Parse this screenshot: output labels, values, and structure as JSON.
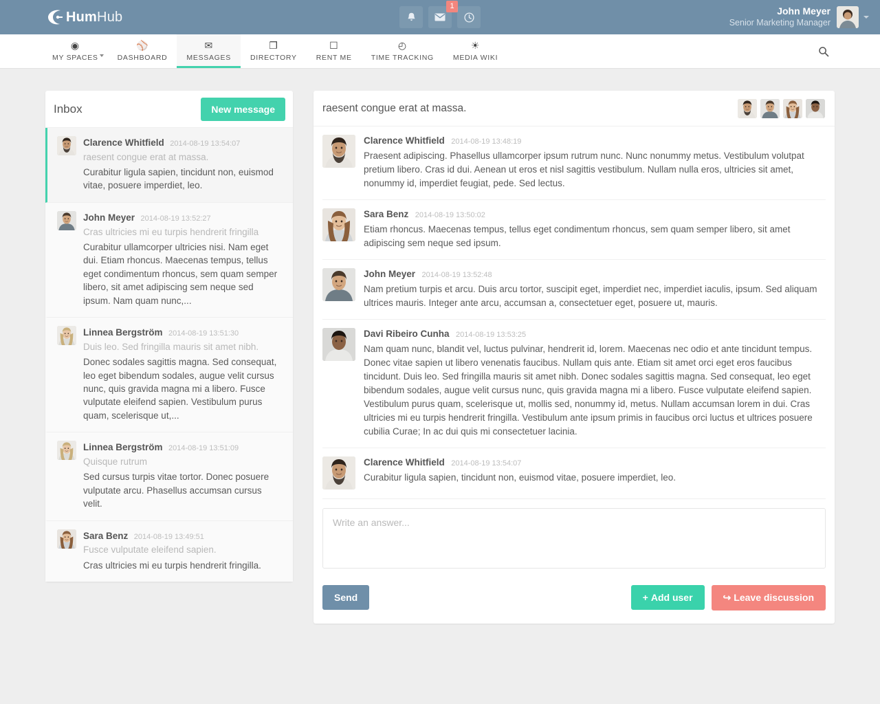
{
  "brand": {
    "name_bold": "Hum",
    "name_light": "Hub"
  },
  "topbar": {
    "icons": [
      {
        "name": "notifications-icon",
        "glyph": "⚑"
      },
      {
        "name": "messages-icon",
        "glyph": "✉"
      },
      {
        "name": "activity-icon",
        "glyph": "◴"
      }
    ],
    "message_badge": "1",
    "user": {
      "name": "John Meyer",
      "role": "Senior Marketing Manager"
    }
  },
  "nav": {
    "items": [
      {
        "label": "MY SPACES",
        "icon": "target-icon",
        "glyph": "◉",
        "caret": true,
        "active": false
      },
      {
        "label": "DASHBOARD",
        "icon": "dashboard-icon",
        "glyph": "⚾",
        "caret": false,
        "active": false
      },
      {
        "label": "MESSAGES",
        "icon": "envelope-icon",
        "glyph": "✉",
        "caret": false,
        "active": true
      },
      {
        "label": "DIRECTORY",
        "icon": "book-icon",
        "glyph": "❐",
        "caret": false,
        "active": false
      },
      {
        "label": "RENT ME",
        "icon": "mobile-icon",
        "glyph": "☐",
        "caret": false,
        "active": false
      },
      {
        "label": "TIME TRACKING",
        "icon": "clock-icon",
        "glyph": "◴",
        "caret": false,
        "active": false
      },
      {
        "label": "MEDIA WIKI",
        "icon": "gear-icon",
        "glyph": "☀",
        "caret": false,
        "active": false
      }
    ],
    "search_icon": "search-icon"
  },
  "inbox": {
    "title": "Inbox",
    "new_message_label": "New message",
    "items": [
      {
        "author": "Clarence Whitfield",
        "time": "2014-08-19 13:54:07",
        "subject": "raesent congue erat at massa.",
        "preview": "Curabitur ligula sapien, tincidunt non, euismod vitae, posuere imperdiet, leo.",
        "state": "active",
        "avatar": "clarence"
      },
      {
        "author": "John Meyer",
        "time": "2014-08-19 13:52:27",
        "subject": "Cras ultricies mi eu turpis hendrerit fringilla",
        "preview": "Curabitur ullamcorper ultricies nisi. Nam eget dui. Etiam rhoncus. Maecenas tempus, tellus eget condimentum rhoncus, sem quam semper libero, sit amet adipiscing sem neque sed ipsum. Nam quam nunc,...",
        "state": "read",
        "avatar": "john"
      },
      {
        "author": "Linnea Bergström",
        "time": "2014-08-19 13:51:30",
        "subject": "Duis leo. Sed fringilla mauris sit amet nibh.",
        "preview": "Donec sodales sagittis magna. Sed consequat, leo eget bibendum sodales, augue velit cursus nunc, quis gravida magna mi a libero. Fusce vulputate eleifend sapien. Vestibulum purus quam, scelerisque ut,...",
        "state": "read",
        "avatar": "linnea"
      },
      {
        "author": "Linnea Bergström",
        "time": "2014-08-19 13:51:09",
        "subject": "Quisque rutrum",
        "preview": "Sed cursus turpis vitae tortor. Donec posuere vulputate arcu. Phasellus accumsan cursus velit.",
        "state": "read",
        "avatar": "linnea"
      },
      {
        "author": "Sara Benz",
        "time": "2014-08-19 13:49:51",
        "subject": "Fusce vulputate eleifend sapien.",
        "preview": "Cras ultricies mi eu turpis hendrerit fringilla.",
        "state": "read",
        "avatar": "sara"
      }
    ]
  },
  "conversation": {
    "title": "raesent congue erat at massa.",
    "participants": [
      "clarence",
      "john",
      "sara",
      "davi"
    ],
    "messages": [
      {
        "author": "Clarence Whitfield",
        "time": "2014-08-19 13:48:19",
        "text": "Praesent adipiscing. Phasellus ullamcorper ipsum rutrum nunc. Nunc nonummy metus. Vestibulum volutpat pretium libero. Cras id dui. Aenean ut eros et nisl sagittis vestibulum. Nullam nulla eros, ultricies sit amet, nonummy id, imperdiet feugiat, pede. Sed lectus.",
        "avatar": "clarence"
      },
      {
        "author": "Sara Benz",
        "time": "2014-08-19 13:50:02",
        "text": "Etiam rhoncus. Maecenas tempus, tellus eget condimentum rhoncus, sem quam semper libero, sit amet adipiscing sem neque sed ipsum.",
        "avatar": "sara"
      },
      {
        "author": "John Meyer",
        "time": "2014-08-19 13:52:48",
        "text": "Nam pretium turpis et arcu. Duis arcu tortor, suscipit eget, imperdiet nec, imperdiet iaculis, ipsum. Sed aliquam ultrices mauris. Integer ante arcu, accumsan a, consectetuer eget, posuere ut, mauris.",
        "avatar": "john"
      },
      {
        "author": "Davi Ribeiro Cunha",
        "time": "2014-08-19 13:53:25",
        "text": "Nam quam nunc, blandit vel, luctus pulvinar, hendrerit id, lorem. Maecenas nec odio et ante tincidunt tempus. Donec vitae sapien ut libero venenatis faucibus. Nullam quis ante. Etiam sit amet orci eget eros faucibus tincidunt. Duis leo. Sed fringilla mauris sit amet nibh. Donec sodales sagittis magna. Sed consequat, leo eget bibendum sodales, augue velit cursus nunc, quis gravida magna mi a libero. Fusce vulputate eleifend sapien. Vestibulum purus quam, scelerisque ut, mollis sed, nonummy id, metus. Nullam accumsan lorem in dui. Cras ultricies mi eu turpis hendrerit fringilla. Vestibulum ante ipsum primis in faucibus orci luctus et ultrices posuere cubilia Curae; In ac dui quis mi consectetuer lacinia.",
        "avatar": "davi"
      },
      {
        "author": "Clarence Whitfield",
        "time": "2014-08-19 13:54:07",
        "text": "Curabitur ligula sapien, tincidunt non, euismod vitae, posuere imperdiet, leo.",
        "avatar": "clarence"
      }
    ],
    "answer_placeholder": "Write an answer...",
    "send_label": "Send",
    "add_user_label": "Add user",
    "add_user_glyph": "+",
    "leave_label": "Leave discussion",
    "leave_glyph": "↪"
  },
  "colors": {
    "topbar": "#708fa8",
    "accent_teal": "#43d2ad",
    "danger": "#f4867f",
    "send_blue": "#6f8fa9",
    "page_bg": "#eeeeee"
  }
}
